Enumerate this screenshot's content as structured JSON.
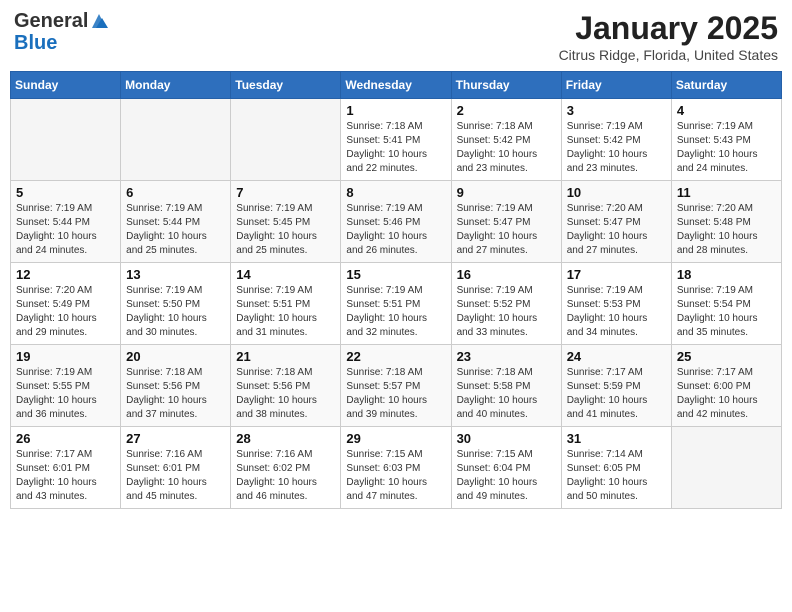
{
  "header": {
    "logo_line1": "General",
    "logo_line2": "Blue",
    "main_title": "January 2025",
    "sub_title": "Citrus Ridge, Florida, United States"
  },
  "days_of_week": [
    "Sunday",
    "Monday",
    "Tuesday",
    "Wednesday",
    "Thursday",
    "Friday",
    "Saturday"
  ],
  "weeks": [
    [
      {
        "day": "",
        "info": ""
      },
      {
        "day": "",
        "info": ""
      },
      {
        "day": "",
        "info": ""
      },
      {
        "day": "1",
        "info": "Sunrise: 7:18 AM\nSunset: 5:41 PM\nDaylight: 10 hours\nand 22 minutes."
      },
      {
        "day": "2",
        "info": "Sunrise: 7:18 AM\nSunset: 5:42 PM\nDaylight: 10 hours\nand 23 minutes."
      },
      {
        "day": "3",
        "info": "Sunrise: 7:19 AM\nSunset: 5:42 PM\nDaylight: 10 hours\nand 23 minutes."
      },
      {
        "day": "4",
        "info": "Sunrise: 7:19 AM\nSunset: 5:43 PM\nDaylight: 10 hours\nand 24 minutes."
      }
    ],
    [
      {
        "day": "5",
        "info": "Sunrise: 7:19 AM\nSunset: 5:44 PM\nDaylight: 10 hours\nand 24 minutes."
      },
      {
        "day": "6",
        "info": "Sunrise: 7:19 AM\nSunset: 5:44 PM\nDaylight: 10 hours\nand 25 minutes."
      },
      {
        "day": "7",
        "info": "Sunrise: 7:19 AM\nSunset: 5:45 PM\nDaylight: 10 hours\nand 25 minutes."
      },
      {
        "day": "8",
        "info": "Sunrise: 7:19 AM\nSunset: 5:46 PM\nDaylight: 10 hours\nand 26 minutes."
      },
      {
        "day": "9",
        "info": "Sunrise: 7:19 AM\nSunset: 5:47 PM\nDaylight: 10 hours\nand 27 minutes."
      },
      {
        "day": "10",
        "info": "Sunrise: 7:20 AM\nSunset: 5:47 PM\nDaylight: 10 hours\nand 27 minutes."
      },
      {
        "day": "11",
        "info": "Sunrise: 7:20 AM\nSunset: 5:48 PM\nDaylight: 10 hours\nand 28 minutes."
      }
    ],
    [
      {
        "day": "12",
        "info": "Sunrise: 7:20 AM\nSunset: 5:49 PM\nDaylight: 10 hours\nand 29 minutes."
      },
      {
        "day": "13",
        "info": "Sunrise: 7:19 AM\nSunset: 5:50 PM\nDaylight: 10 hours\nand 30 minutes."
      },
      {
        "day": "14",
        "info": "Sunrise: 7:19 AM\nSunset: 5:51 PM\nDaylight: 10 hours\nand 31 minutes."
      },
      {
        "day": "15",
        "info": "Sunrise: 7:19 AM\nSunset: 5:51 PM\nDaylight: 10 hours\nand 32 minutes."
      },
      {
        "day": "16",
        "info": "Sunrise: 7:19 AM\nSunset: 5:52 PM\nDaylight: 10 hours\nand 33 minutes."
      },
      {
        "day": "17",
        "info": "Sunrise: 7:19 AM\nSunset: 5:53 PM\nDaylight: 10 hours\nand 34 minutes."
      },
      {
        "day": "18",
        "info": "Sunrise: 7:19 AM\nSunset: 5:54 PM\nDaylight: 10 hours\nand 35 minutes."
      }
    ],
    [
      {
        "day": "19",
        "info": "Sunrise: 7:19 AM\nSunset: 5:55 PM\nDaylight: 10 hours\nand 36 minutes."
      },
      {
        "day": "20",
        "info": "Sunrise: 7:18 AM\nSunset: 5:56 PM\nDaylight: 10 hours\nand 37 minutes."
      },
      {
        "day": "21",
        "info": "Sunrise: 7:18 AM\nSunset: 5:56 PM\nDaylight: 10 hours\nand 38 minutes."
      },
      {
        "day": "22",
        "info": "Sunrise: 7:18 AM\nSunset: 5:57 PM\nDaylight: 10 hours\nand 39 minutes."
      },
      {
        "day": "23",
        "info": "Sunrise: 7:18 AM\nSunset: 5:58 PM\nDaylight: 10 hours\nand 40 minutes."
      },
      {
        "day": "24",
        "info": "Sunrise: 7:17 AM\nSunset: 5:59 PM\nDaylight: 10 hours\nand 41 minutes."
      },
      {
        "day": "25",
        "info": "Sunrise: 7:17 AM\nSunset: 6:00 PM\nDaylight: 10 hours\nand 42 minutes."
      }
    ],
    [
      {
        "day": "26",
        "info": "Sunrise: 7:17 AM\nSunset: 6:01 PM\nDaylight: 10 hours\nand 43 minutes."
      },
      {
        "day": "27",
        "info": "Sunrise: 7:16 AM\nSunset: 6:01 PM\nDaylight: 10 hours\nand 45 minutes."
      },
      {
        "day": "28",
        "info": "Sunrise: 7:16 AM\nSunset: 6:02 PM\nDaylight: 10 hours\nand 46 minutes."
      },
      {
        "day": "29",
        "info": "Sunrise: 7:15 AM\nSunset: 6:03 PM\nDaylight: 10 hours\nand 47 minutes."
      },
      {
        "day": "30",
        "info": "Sunrise: 7:15 AM\nSunset: 6:04 PM\nDaylight: 10 hours\nand 49 minutes."
      },
      {
        "day": "31",
        "info": "Sunrise: 7:14 AM\nSunset: 6:05 PM\nDaylight: 10 hours\nand 50 minutes."
      },
      {
        "day": "",
        "info": ""
      }
    ]
  ]
}
